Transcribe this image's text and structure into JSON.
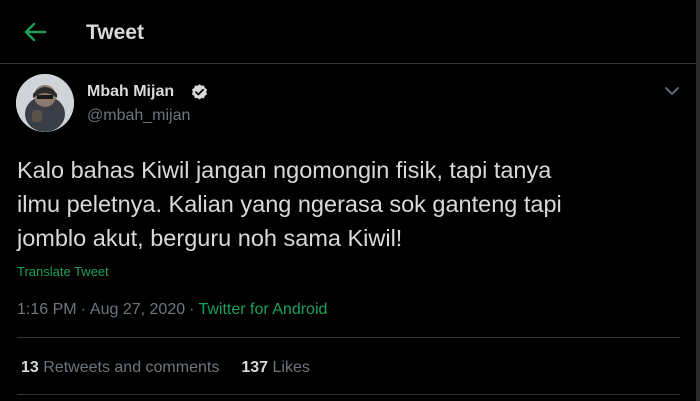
{
  "header": {
    "back_icon": "arrow-left-icon",
    "title": "Tweet"
  },
  "tweet": {
    "author": {
      "display_name": "Mbah Mijan",
      "handle": "@mbah_mijan",
      "verified": true,
      "verified_icon": "verified-badge-icon"
    },
    "menu_icon": "chevron-down-icon",
    "text_lines": [
      "Kalo bahas Kiwil jangan ngomongin fisik, tapi tanya",
      "ilmu peletnya. Kalian yang ngerasa sok ganteng tapi",
      "jomblo akut, berguru noh sama Kiwil!"
    ],
    "translate_label": "Translate Tweet",
    "time": "1:16 PM",
    "separator": "·",
    "date": "Aug 27, 2020",
    "source": "Twitter for Android",
    "retweets_count": "13",
    "retweets_label": "Retweets and comments",
    "likes_count": "137",
    "likes_label": "Likes"
  },
  "colors": {
    "background": "#000000",
    "text": "#d9d9d9",
    "secondary_text": "#6e767d",
    "accent": "#1da05a",
    "divider": "#2f3336"
  }
}
